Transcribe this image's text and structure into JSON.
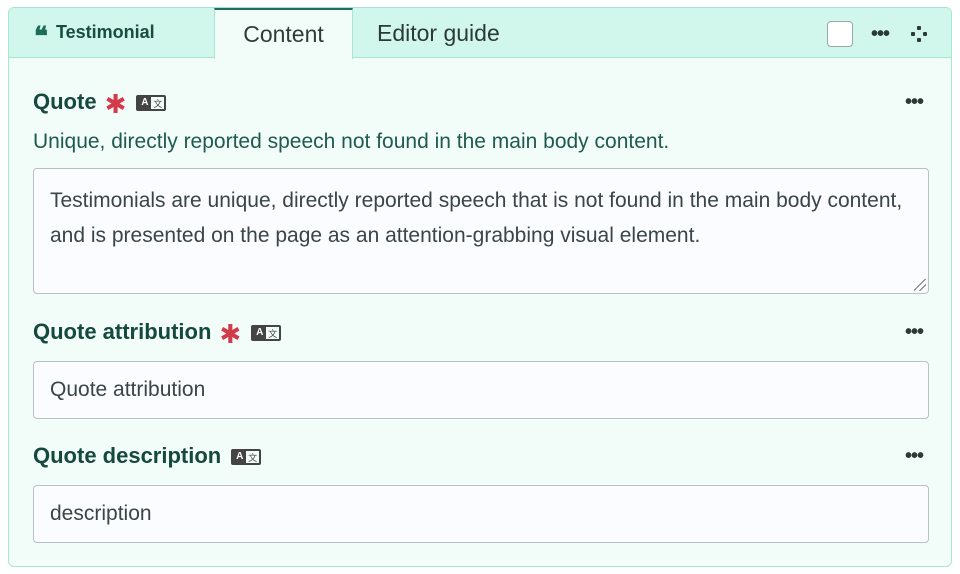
{
  "header": {
    "block_label": "Testimonial",
    "block_icon": "quote-icon",
    "tabs": [
      {
        "label": "Content",
        "active": true
      },
      {
        "label": "Editor guide",
        "active": false
      }
    ],
    "menu_label": "•••"
  },
  "fields": {
    "quote": {
      "label": "Quote",
      "required_mark": "✱",
      "help_text": "Unique, directly reported speech not found in the main body content.",
      "value": "Testimonials are unique, directly reported speech that is not found in the main body content, and is presented on the page as an attention-grabbing visual element.",
      "menu_label": "•••"
    },
    "attribution": {
      "label": "Quote attribution",
      "required_mark": "✱",
      "value": "Quote attribution",
      "menu_label": "•••"
    },
    "description": {
      "label": "Quote description",
      "value": "description",
      "menu_label": "•••"
    }
  },
  "colors": {
    "header_bg": "#d1f7ec",
    "panel_bg": "#f2fcf9",
    "label_text": "#15493d",
    "required": "#d33a4a"
  }
}
